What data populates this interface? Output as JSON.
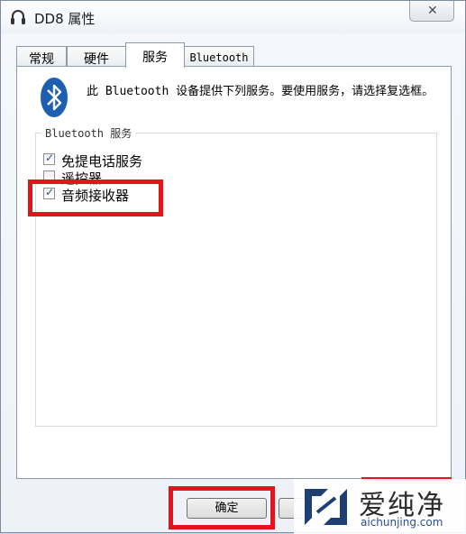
{
  "window": {
    "title": "DD8 属性",
    "close_label": "✕"
  },
  "tabs": [
    {
      "label": "常规",
      "active": false
    },
    {
      "label": "硬件",
      "active": false
    },
    {
      "label": "服务",
      "active": true
    },
    {
      "label": "Bluetooth",
      "active": false
    }
  ],
  "panel": {
    "description": "此 Bluetooth 设备提供下列服务。要使用服务，请选择复选框。",
    "group_title": "Bluetooth 服务",
    "services": [
      {
        "label": "免提电话服务",
        "checked": true
      },
      {
        "label": "遥控器",
        "checked": false
      },
      {
        "label": "音频接收器",
        "checked": true
      }
    ]
  },
  "buttons": {
    "ok_label": "确定"
  },
  "watermark": {
    "name": "爱纯净",
    "url": "aichunjing.com"
  },
  "colors": {
    "highlight": "#e2151c",
    "bluetooth_blue": "#1f5fb0",
    "checkmark": "#2a4f8f"
  },
  "icons": {
    "title": "headset-icon",
    "bluetooth": "bluetooth-icon",
    "watermark": "watermark-logo-icon"
  }
}
